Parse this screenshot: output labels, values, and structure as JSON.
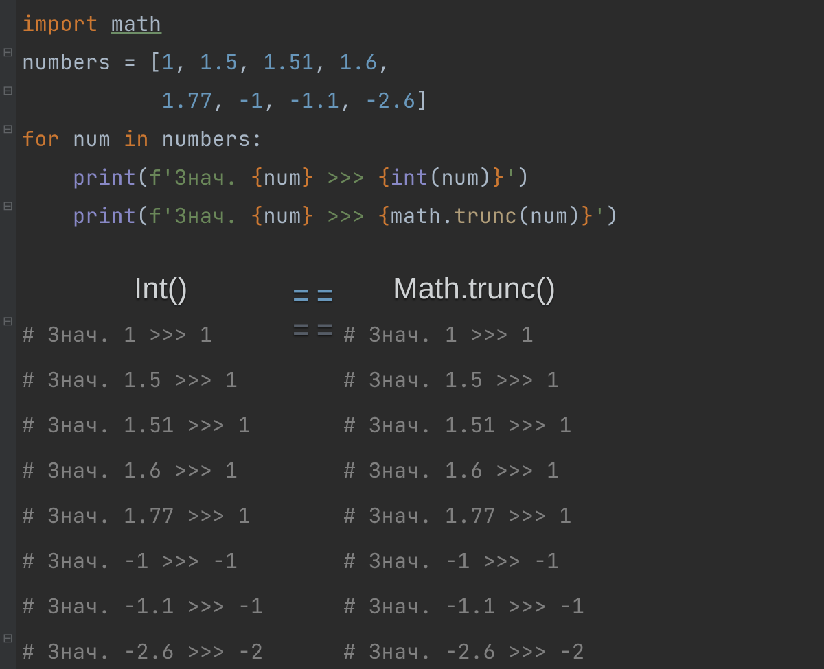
{
  "code": {
    "line1": {
      "kw_import": "import",
      "mod": "math"
    },
    "line2": {
      "var": "numbers",
      "eq": "=",
      "lbr": "[",
      "n1": "1",
      "c": ",",
      "n2": "1.5",
      "n3": "1.51",
      "n4": "1.6"
    },
    "line3": {
      "n5": "1.77",
      "n6": "-1",
      "n7": "-1.1",
      "n8": "-2.6",
      "rbr": "]"
    },
    "line4": {
      "kw_for": "for",
      "v": "num",
      "kw_in": "in",
      "it": "numbers",
      "colon": ":"
    },
    "line5": {
      "fn": "print",
      "lp": "(",
      "pf": "f'",
      "s1": "Знач. ",
      "lb": "{",
      "e1": "num",
      "rb": "}",
      "s2": " >>> ",
      "lb2": "{",
      "e2a": "int",
      "e2p": "(",
      "e2v": "num",
      "e2q": ")",
      "rb2": "}",
      "sq": "'",
      "rp": ")"
    },
    "line6": {
      "fn": "print",
      "lp": "(",
      "pf": "f'",
      "s1": "Знач. ",
      "lb": "{",
      "e1": "num",
      "rb": "}",
      "s2": " >>> ",
      "lb2": "{",
      "e2a": "math",
      "e2d": ".",
      "e2b": "trunc",
      "e2p": "(",
      "e2v": "num",
      "e2q": ")",
      "rb2": "}",
      "sq": "'",
      "rp": ")"
    }
  },
  "overlay": {
    "int_label": "Int()",
    "eq_label": "==",
    "trunc_label": "Math.trunc()"
  },
  "output_left": [
    "# Знач. 1 >>> 1",
    "# Знач. 1.5 >>> 1",
    "# Знач. 1.51 >>> 1",
    "# Знач. 1.6 >>> 1",
    "# Знач. 1.77 >>> 1",
    "# Знач. -1 >>> -1",
    "# Знач. -1.1 >>> -1",
    "# Знач. -2.6 >>> -2"
  ],
  "output_right": [
    "# Знач. 1 >>> 1",
    "# Знач. 1.5 >>> 1",
    "# Знач. 1.51 >>> 1",
    "# Знач. 1.6 >>> 1",
    "# Знач. 1.77 >>> 1",
    "# Знач. -1 >>> -1",
    "# Знач. -1.1 >>> -1",
    "# Знач. -2.6 >>> -2"
  ]
}
